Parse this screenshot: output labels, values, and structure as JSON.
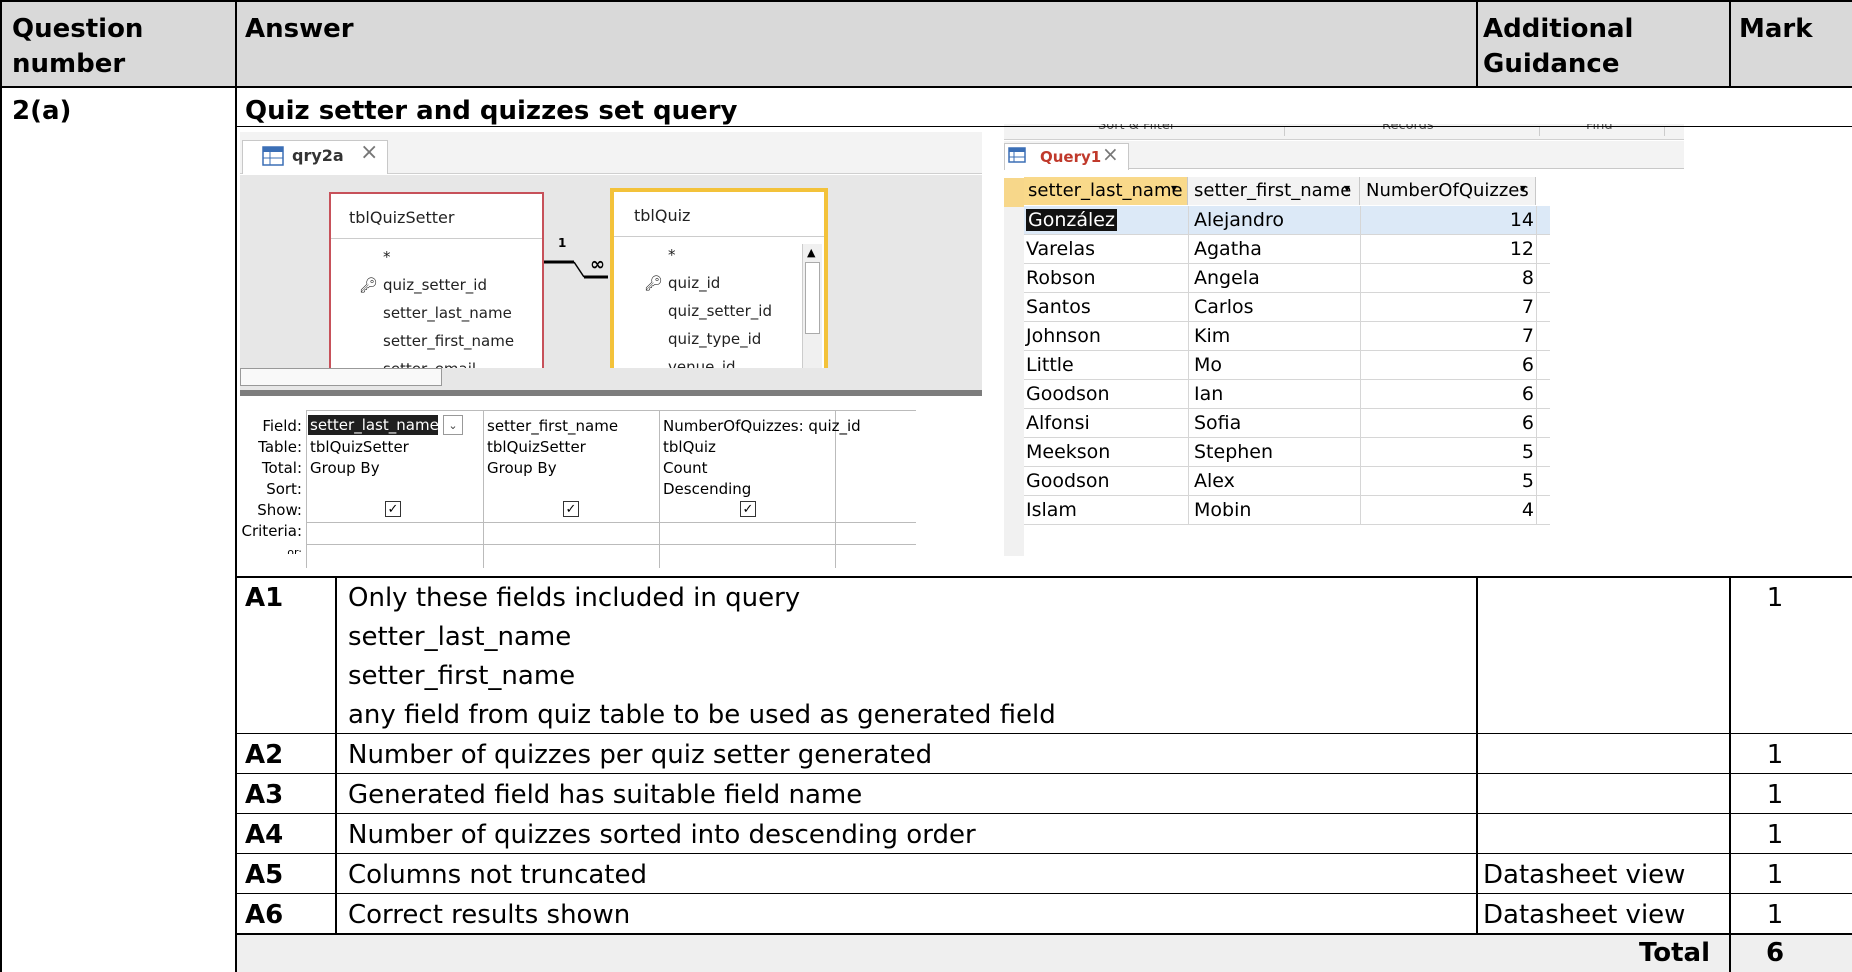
{
  "header": {
    "question_number": "Question number",
    "answer": "Answer",
    "additional_guidance": "Additional Guidance",
    "mark": "Mark"
  },
  "question": {
    "number": "2(a)",
    "title": "Quiz setter and quizzes set query"
  },
  "design_view": {
    "tab_title": "qry2a",
    "tables": [
      {
        "name": "tblQuizSetter",
        "fields": [
          "*",
          "quiz_setter_id",
          "setter_last_name",
          "setter_first_name",
          "setter_email"
        ]
      },
      {
        "name": "tblQuiz",
        "fields": [
          "*",
          "quiz_id",
          "quiz_setter_id",
          "quiz_type_id",
          "venue_id"
        ]
      }
    ],
    "relationship": {
      "one": "1",
      "many": "∞"
    },
    "grid_labels": [
      "Field:",
      "Table:",
      "Total:",
      "Sort:",
      "Show:",
      "Criteria:",
      "or:"
    ],
    "columns": [
      {
        "field": "setter_last_name",
        "table": "tblQuizSetter",
        "total": "Group By",
        "sort": "",
        "show": true
      },
      {
        "field": "setter_first_name",
        "table": "tblQuizSetter",
        "total": "Group By",
        "sort": "",
        "show": true
      },
      {
        "field": "NumberOfQuizzes: quiz_id",
        "table": "tblQuiz",
        "total": "Count",
        "sort": "Descending",
        "show": true
      }
    ]
  },
  "datasheet": {
    "ribbon_labels": [
      "Sort & Filter",
      "Records",
      "Find"
    ],
    "tab_title": "Query1",
    "columns": [
      "setter_last_name",
      "setter_first_name",
      "NumberOfQuizzes"
    ],
    "rows": [
      [
        "González",
        "Alejandro",
        "14"
      ],
      [
        "Varelas",
        "Agatha",
        "12"
      ],
      [
        "Robson",
        "Angela",
        "8"
      ],
      [
        "Santos",
        "Carlos",
        "7"
      ],
      [
        "Johnson",
        "Kim",
        "7"
      ],
      [
        "Little",
        "Mo",
        "6"
      ],
      [
        "Goodson",
        "Ian",
        "6"
      ],
      [
        "Alfonsi",
        "Sofia",
        "6"
      ],
      [
        "Meekson",
        "Stephen",
        "5"
      ],
      [
        "Goodson",
        "Alex",
        "5"
      ],
      [
        "Islam",
        "Mobin",
        "4"
      ]
    ]
  },
  "marks": [
    {
      "id": "A1",
      "lines": [
        "Only these fields included in query",
        "setter_last_name",
        "setter_first_name",
        "any field from quiz table to be used as generated field"
      ],
      "guidance": "",
      "mark": "1"
    },
    {
      "id": "A2",
      "lines": [
        "Number of quizzes per quiz setter generated"
      ],
      "guidance": "",
      "mark": "1"
    },
    {
      "id": "A3",
      "lines": [
        "Generated field has suitable field name"
      ],
      "guidance": "",
      "mark": "1"
    },
    {
      "id": "A4",
      "lines": [
        "Number of quizzes sorted into descending order"
      ],
      "guidance": "",
      "mark": "1"
    },
    {
      "id": "A5",
      "lines": [
        "Columns not truncated"
      ],
      "guidance": "Datasheet view",
      "mark": "1"
    },
    {
      "id": "A6",
      "lines": [
        "Correct results shown"
      ],
      "guidance": "Datasheet view",
      "mark": "1"
    }
  ],
  "total": {
    "label": "Total",
    "value": "6"
  }
}
